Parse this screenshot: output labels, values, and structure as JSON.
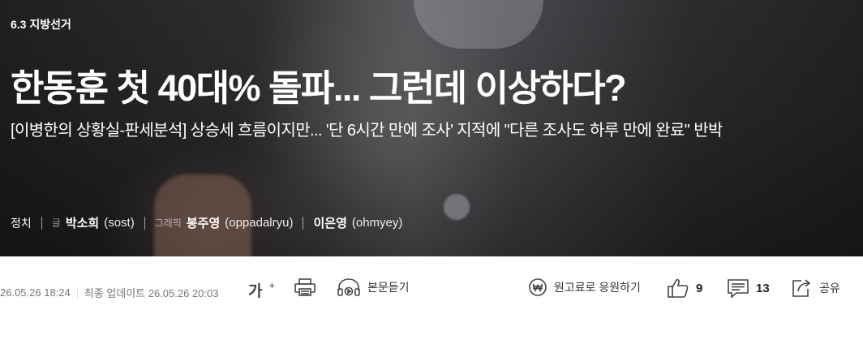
{
  "article": {
    "section": "6.3 지방선거",
    "headline": "한동훈 첫 40대% 돌파... 그런데 이상하다?",
    "subheadline": "[이병한의 상황실-판세분석] 상승세 흐름이지만... '단 6시간 만에 조사' 지적에 \"다른 조사도 하루 만에 완료\" 반박",
    "category": "정치",
    "byline": [
      {
        "role": "글",
        "name": "박소희",
        "handle": "(sost)"
      },
      {
        "role": "그래픽",
        "name": "봉주영",
        "handle": "(oppadalryu)"
      },
      {
        "role": "",
        "name": "이은영",
        "handle": "(ohmyey)"
      }
    ]
  },
  "toolbar": {
    "published": "26.05.26 18:24",
    "updated": "최종 업데이트 26.05.26 20:03",
    "font_label": "가",
    "font_sup": "+",
    "listen_label": "본문듣기",
    "support_label": "원고료로 응원하기",
    "like_count": "9",
    "comment_count": "13",
    "share_label": "공유"
  }
}
